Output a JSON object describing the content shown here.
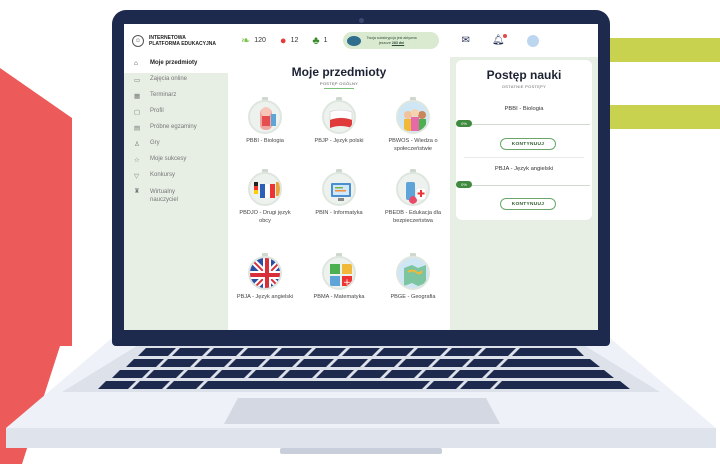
{
  "header": {
    "logo_line1": "INTERNETOWA",
    "logo_line2": "PLATFORMA EDUKACYJNA",
    "stats": [
      {
        "icon": "leaf-icon",
        "value": "120",
        "color": "#7cc24a"
      },
      {
        "icon": "apple-icon",
        "value": "12",
        "color": "#e23b3b"
      },
      {
        "icon": "tree-icon",
        "value": "1",
        "color": "#3a8a2c"
      }
    ],
    "subscription_line1": "Twoja subskrypcja jest aktywna",
    "subscription_line2": "jeszcze",
    "subscription_days": "283 dni",
    "icons": [
      "mail-icon",
      "bell-icon",
      "avatar"
    ]
  },
  "sidebar": {
    "items": [
      {
        "label": "Moje przedmioty",
        "icon": "home-icon",
        "active": true
      },
      {
        "label": "Zajęcia online",
        "icon": "monitor-icon",
        "active": false
      },
      {
        "label": "Terminarz",
        "icon": "calendar-icon",
        "active": false
      },
      {
        "label": "Profil",
        "icon": "profile-icon",
        "active": false
      },
      {
        "label": "Próbne egzaminy",
        "icon": "exam-icon",
        "active": false
      },
      {
        "label": "Gry",
        "icon": "games-icon",
        "active": false
      },
      {
        "label": "Moje sukcesy",
        "icon": "star-icon",
        "active": false
      },
      {
        "label": "Konkursy",
        "icon": "trophy-icon",
        "active": false
      },
      {
        "label": "Wirtualny nauczyciel",
        "icon": "teacher-icon",
        "active": false
      }
    ]
  },
  "main": {
    "title": "Moje przedmioty",
    "subtitle": "POSTĘP OGÓLNY",
    "subjects": [
      {
        "label": "PBBI - Biologia",
        "icon": "biology-icon"
      },
      {
        "label": "PBJP - Język polski",
        "icon": "polish-icon"
      },
      {
        "label": "PBWOS - Wiedza o społeczeństwie",
        "icon": "society-icon"
      },
      {
        "label": "PBDJO - Drugi język obcy",
        "icon": "flags-icon"
      },
      {
        "label": "PBIN - Informatyka",
        "icon": "computer-icon"
      },
      {
        "label": "PBEDB - Edukacja dla bezpieczeństwa",
        "icon": "first-aid-icon"
      },
      {
        "label": "PBJA - Język angielski",
        "icon": "uk-flag-icon"
      },
      {
        "label": "PBMA - Matematyka",
        "icon": "math-icon"
      },
      {
        "label": "PBGE - Geografia",
        "icon": "map-icon"
      }
    ]
  },
  "progress": {
    "title": "Postęp nauki",
    "subtitle": "OSTATNIE POSTĘPY",
    "button_label": "KONTYNUUJ",
    "items": [
      {
        "label": "PBBI - Biologia",
        "percent": "0%"
      },
      {
        "label": "PBJA - Język angielski",
        "percent": "0%"
      }
    ]
  }
}
